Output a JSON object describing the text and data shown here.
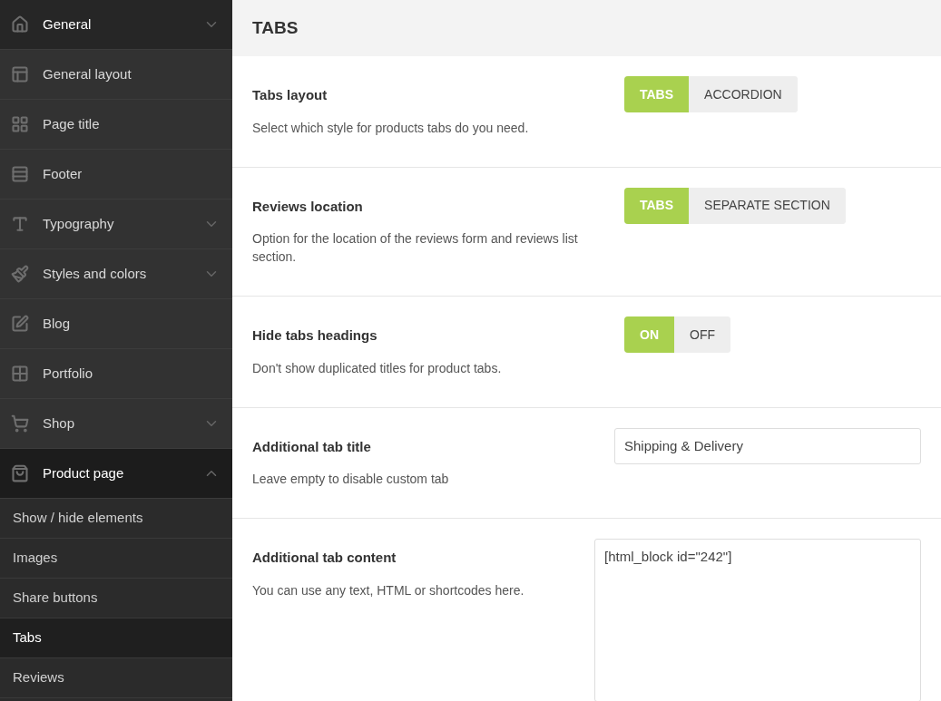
{
  "sidebar": {
    "items": [
      {
        "label": "General",
        "expandable": true,
        "expanded": false,
        "selected": true
      },
      {
        "label": "General layout",
        "expandable": false,
        "expanded": false,
        "selected": false
      },
      {
        "label": "Page title",
        "expandable": false,
        "expanded": false,
        "selected": false
      },
      {
        "label": "Footer",
        "expandable": false,
        "expanded": false,
        "selected": false
      },
      {
        "label": "Typography",
        "expandable": true,
        "expanded": false,
        "selected": false
      },
      {
        "label": "Styles and colors",
        "expandable": true,
        "expanded": false,
        "selected": false
      },
      {
        "label": "Blog",
        "expandable": false,
        "expanded": false,
        "selected": false
      },
      {
        "label": "Portfolio",
        "expandable": false,
        "expanded": false,
        "selected": false
      },
      {
        "label": "Shop",
        "expandable": true,
        "expanded": false,
        "selected": false
      },
      {
        "label": "Product page",
        "expandable": true,
        "expanded": true,
        "selected": true,
        "children": [
          {
            "label": "Show / hide elements",
            "selected": false
          },
          {
            "label": "Images",
            "selected": false
          },
          {
            "label": "Share buttons",
            "selected": false
          },
          {
            "label": "Tabs",
            "selected": true
          },
          {
            "label": "Reviews",
            "selected": false
          }
        ]
      }
    ]
  },
  "section": {
    "title": "TABS"
  },
  "settings": [
    {
      "kind": "segmented",
      "title": "Tabs layout",
      "description": "Select which style for products tabs do you need.",
      "options": [
        {
          "label": "TABS",
          "selected": true
        },
        {
          "label": "ACCORDION",
          "selected": false
        }
      ]
    },
    {
      "kind": "segmented",
      "title": "Reviews location",
      "description": "Option for the location of the reviews form and reviews list section.",
      "options": [
        {
          "label": "TABS",
          "selected": true
        },
        {
          "label": "SEPARATE SECTION",
          "selected": false
        }
      ]
    },
    {
      "kind": "segmented",
      "title": "Hide tabs headings",
      "description": "Don't show duplicated titles for product tabs.",
      "options": [
        {
          "label": "ON",
          "selected": true
        },
        {
          "label": "OFF",
          "selected": false
        }
      ]
    },
    {
      "kind": "text",
      "title": "Additional tab title",
      "description": "Leave empty to disable custom tab",
      "value": "Shipping & Delivery"
    },
    {
      "kind": "textarea",
      "title": "Additional tab content",
      "description": "You can use any text, HTML or shortcodes here.",
      "value": "[html_block id=\"242\"]"
    }
  ]
}
